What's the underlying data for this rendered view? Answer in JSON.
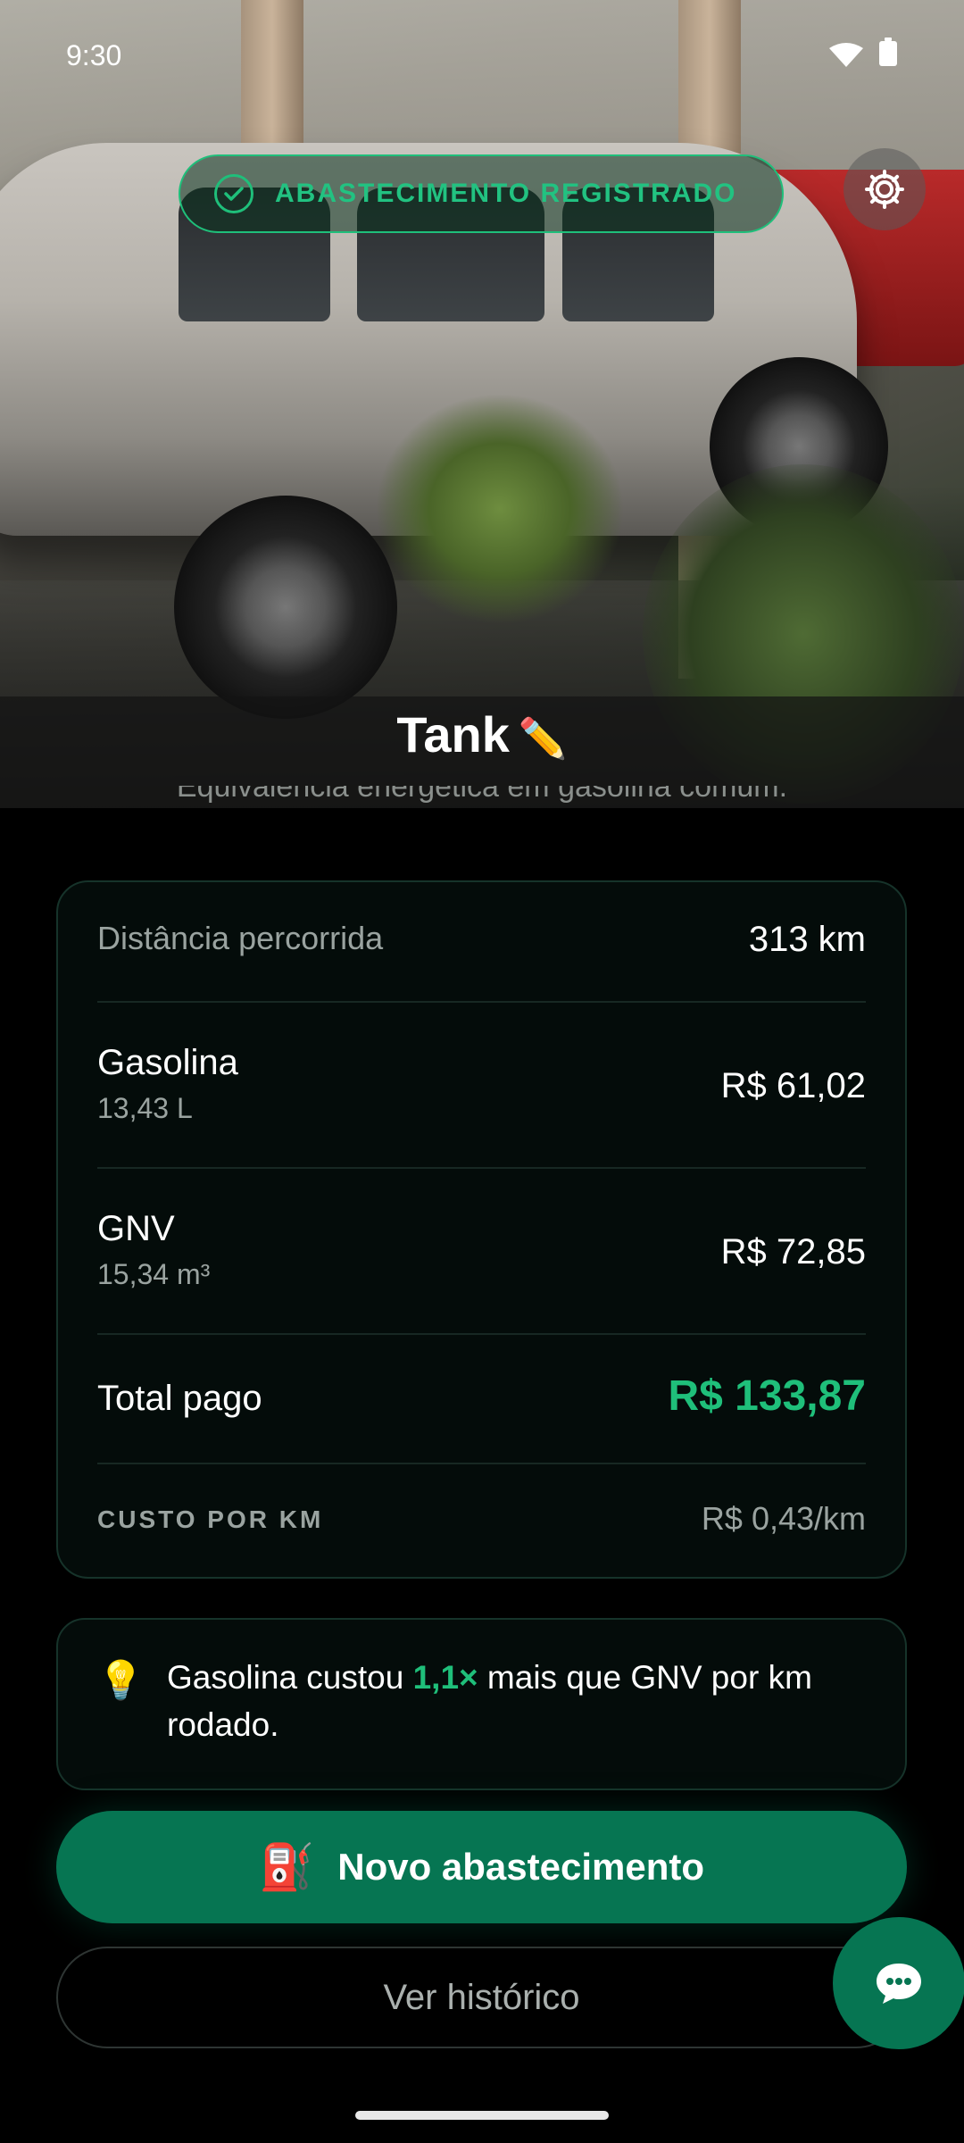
{
  "status_bar": {
    "time": "9:30"
  },
  "badge": {
    "label": "ABASTECIMENTO REGISTRADO"
  },
  "vehicle": {
    "name": "Tank",
    "edit_icon": "pencil-icon"
  },
  "subtitle_partial": "Equivalência energética em gasolina comum.",
  "summary": {
    "distance": {
      "label": "Distância percorrida",
      "value": "313 km"
    },
    "fuels": [
      {
        "name": "Gasolina",
        "quantity": "13,43 L",
        "cost": "R$ 61,02"
      },
      {
        "name": "GNV",
        "quantity": "15,34 m³",
        "cost": "R$ 72,85"
      }
    ],
    "total": {
      "label": "Total pago",
      "value": "R$ 133,87"
    },
    "per_km": {
      "label": "CUSTO POR KM",
      "value": "R$ 0,43/km"
    }
  },
  "tip": {
    "prefix": "Gasolina custou ",
    "highlight": "1,1×",
    "suffix": " mais que GNV por km rodado."
  },
  "actions": {
    "primary": "Novo abastecimento",
    "secondary": "Ver histórico"
  },
  "colors": {
    "accent": "#1fbf7a",
    "primary_button": "#067552",
    "card_bg": "#040c0a"
  }
}
